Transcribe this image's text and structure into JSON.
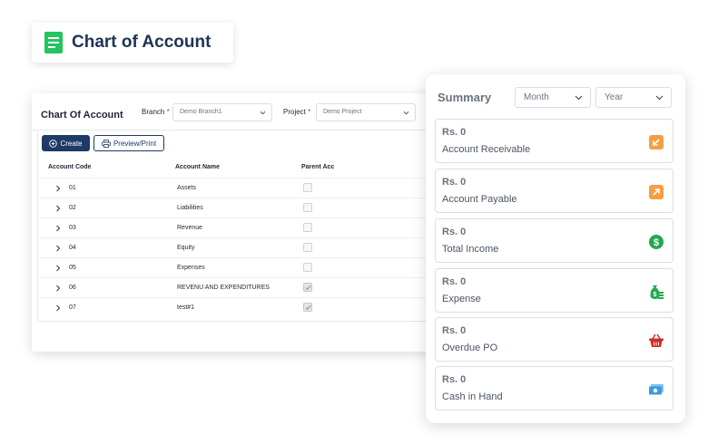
{
  "header": {
    "title": "Chart of Account",
    "icon": "document-icon",
    "icon_color": "#22c55e"
  },
  "panel": {
    "title": "Chart Of Account",
    "branch_label": "Branch",
    "branch_value": "Demo Branch1",
    "project_label": "Project",
    "project_value": "Demo Project",
    "required_mark": "*",
    "create_label": "Create",
    "preview_label": "Preview/Print",
    "columns": [
      "Account Code",
      "Account Name",
      "Parent Acc"
    ],
    "rows": [
      {
        "code": "01",
        "name": "Assets",
        "parent": false
      },
      {
        "code": "02",
        "name": "Liabilities",
        "parent": false
      },
      {
        "code": "03",
        "name": "Revenue",
        "parent": false
      },
      {
        "code": "04",
        "name": "Equity",
        "parent": false
      },
      {
        "code": "05",
        "name": "Expenses",
        "parent": false
      },
      {
        "code": "06",
        "name": "REVENU AND EXPENDITURES",
        "parent": true
      },
      {
        "code": "07",
        "name": "test#1",
        "parent": true
      }
    ]
  },
  "summary": {
    "title": "Summary",
    "month_label": "Month",
    "year_label": "Year",
    "cards": [
      {
        "amount": "Rs. 0",
        "label": "Account Receivable",
        "icon": "arrow-down-left-icon",
        "color": "#f59e42"
      },
      {
        "amount": "Rs. 0",
        "label": "Account Payable",
        "icon": "arrow-up-right-icon",
        "color": "#f59e42"
      },
      {
        "amount": "Rs. 0",
        "label": "Total Income",
        "icon": "dollar-coin-icon",
        "color": "#22a94f"
      },
      {
        "amount": "Rs. 0",
        "label": "Expense",
        "icon": "money-bag-icon",
        "color": "#22a94f"
      },
      {
        "amount": "Rs. 0",
        "label": "Overdue PO",
        "icon": "basket-icon",
        "color": "#d62828"
      },
      {
        "amount": "Rs. 0",
        "label": "Cash in Hand",
        "icon": "cash-icon",
        "color": "#3b9ae1"
      }
    ]
  }
}
